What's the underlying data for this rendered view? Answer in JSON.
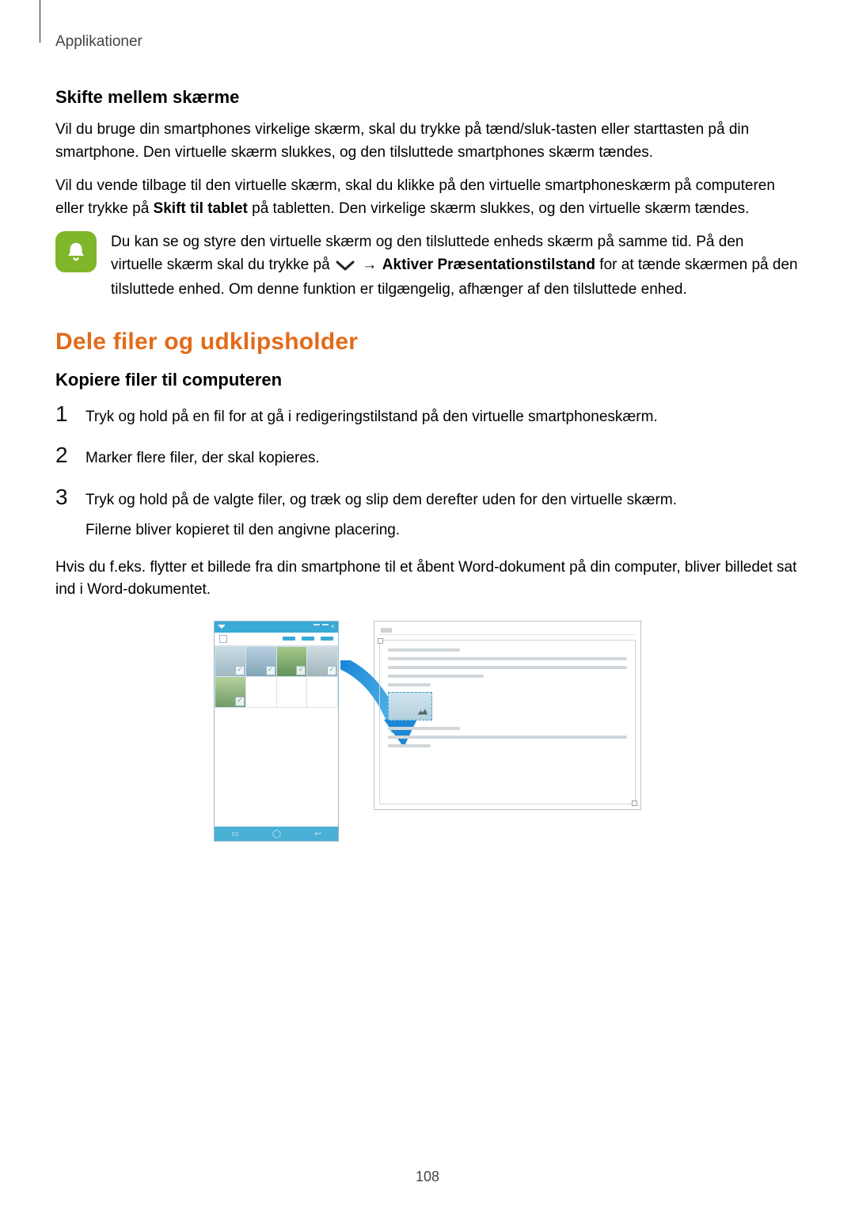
{
  "header": "Applikationer",
  "section1": {
    "heading": "Skifte mellem skærme",
    "para1": "Vil du bruge din smartphones virkelige skærm, skal du trykke på tænd/sluk-tasten eller starttasten på din smartphone. Den virtuelle skærm slukkes, og den tilsluttede smartphones skærm tændes.",
    "para2_pre": "Vil du vende tilbage til den virtuelle skærm, skal du klikke på den virtuelle smartphoneskærm på computeren eller trykke på ",
    "para2_bold": "Skift til tablet",
    "para2_post": " på tabletten. Den virkelige skærm slukkes, og den virtuelle skærm tændes.",
    "note": {
      "line1": "Du kan se og styre den virtuelle skærm og den tilsluttede enheds skærm på samme tid.",
      "line2_pre": "På den virtuelle skærm skal du trykke på ",
      "line2_arrow": "→",
      "line2_bold": " Aktiver Præsentationstilstand",
      "line2_post": " for at tænde skærmen på den tilsluttede enhed. Om denne funktion er tilgængelig, afhænger af den tilsluttede enhed."
    }
  },
  "section2": {
    "heading_orange": "Dele filer og udklipsholder",
    "subheading": "Kopiere filer til computeren",
    "steps": {
      "n1": "1",
      "t1": "Tryk og hold på en fil for at gå i redigeringstilstand på den virtuelle smartphoneskærm.",
      "n2": "2",
      "t2": "Marker flere filer, der skal kopieres.",
      "n3": "3",
      "t3": "Tryk og hold på de valgte filer, og træk og slip dem derefter uden for den virtuelle skærm.",
      "t3_sub": "Filerne bliver kopieret til den angivne placering."
    },
    "para_after": "Hvis du f.eks. flytter et billede fra din smartphone til et åbent Word-dokument på din computer, bliver billedet sat ind i Word-dokumentet."
  },
  "pagenum": "108"
}
